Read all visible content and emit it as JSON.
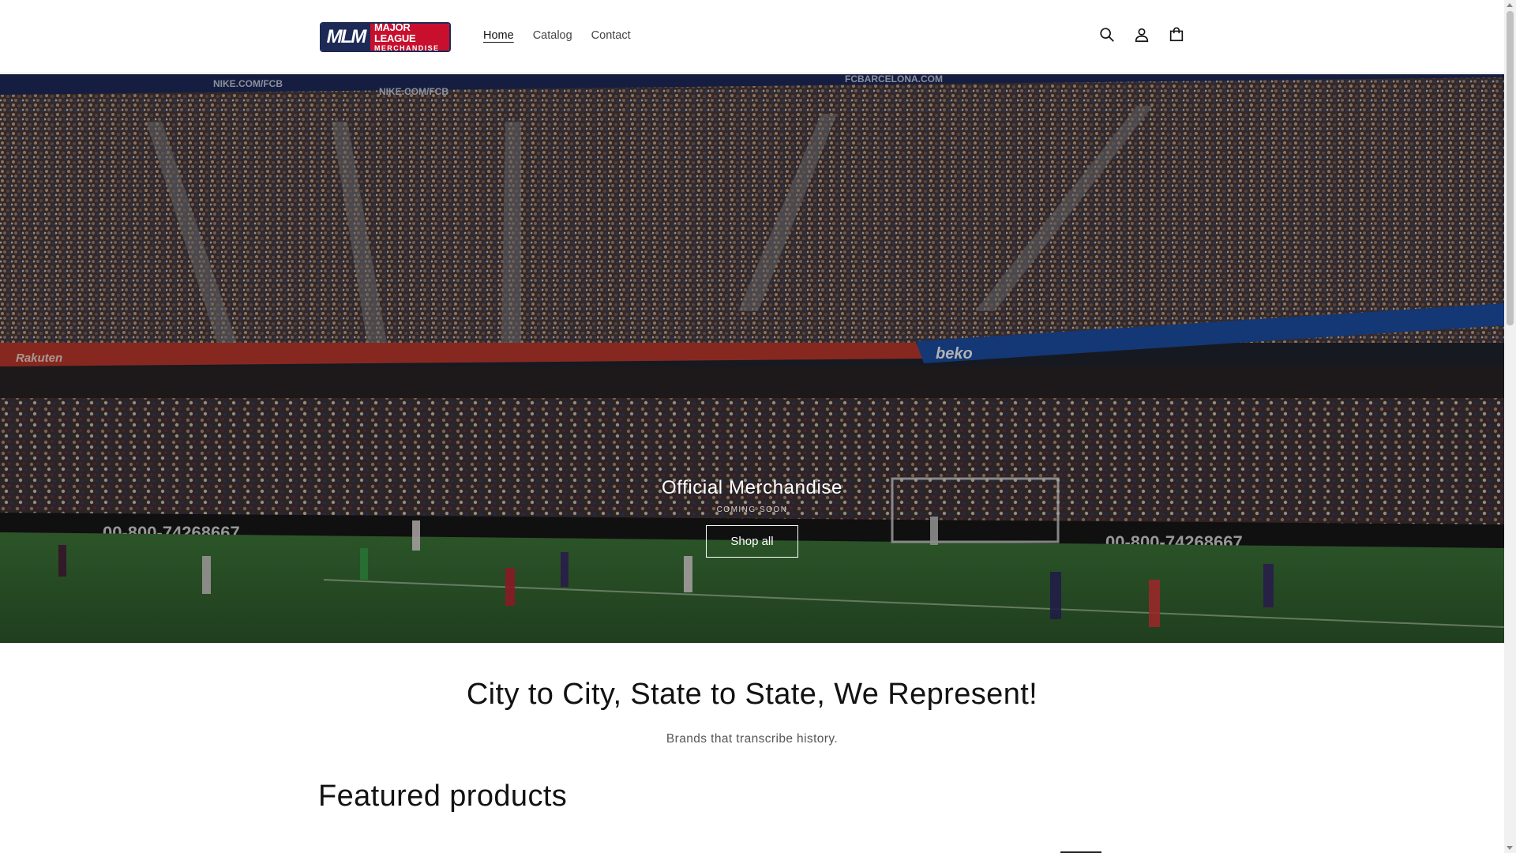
{
  "brand": {
    "logo_mark": "MLM",
    "logo_line1": "MAJOR LEAGUE",
    "logo_line2": "MERCHANDISE",
    "primary_color": "#1d2a55",
    "accent_color": "#c8102e"
  },
  "nav": {
    "items": [
      {
        "label": "Home",
        "active": true
      },
      {
        "label": "Catalog",
        "active": false
      },
      {
        "label": "Contact",
        "active": false
      }
    ]
  },
  "header_icons": [
    "search-icon",
    "account-icon",
    "cart-icon"
  ],
  "hero": {
    "title": "Official Merchandise",
    "subtitle": "COMING SOON",
    "button_label": "Shop all",
    "banner_texts": {
      "top": [
        "NIKE.COM/FCB",
        "NIKE.COM/FCB",
        "FCBARCELONA.COM"
      ],
      "rakuten": "Rakuten",
      "beko": "beko",
      "phone": "00-800-74268667"
    }
  },
  "rich_text": {
    "heading": "City to City, State to State, We Represent!",
    "body": "Brands that transcribe history."
  },
  "featured": {
    "heading": "Featured products"
  }
}
